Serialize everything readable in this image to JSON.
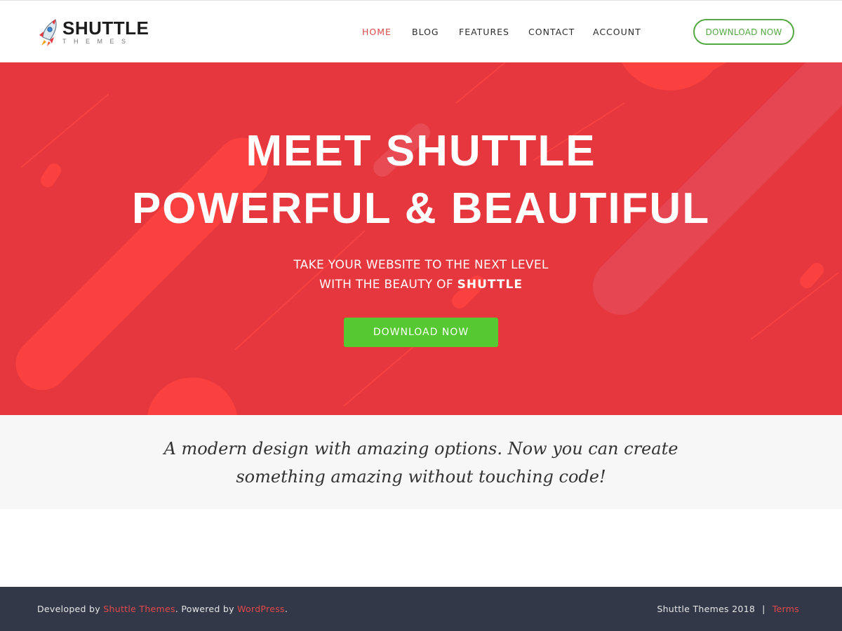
{
  "header": {
    "logo": {
      "name": "SHUTTLE",
      "sub": "THEMES"
    },
    "nav": [
      {
        "label": "HOME",
        "active": true
      },
      {
        "label": "BLOG"
      },
      {
        "label": "FEATURES"
      },
      {
        "label": "CONTACT"
      },
      {
        "label": "ACCOUNT"
      }
    ],
    "cta_label": "DOWNLOAD NOW"
  },
  "hero": {
    "title_line1": "MEET SHUTTLE",
    "title_line2": "POWERFUL & BEAUTIFUL",
    "sub_line1": "TAKE YOUR WEBSITE TO THE NEXT LEVEL",
    "sub_line2_prefix": "WITH THE BEAUTY OF ",
    "sub_line2_strong": "SHUTTLE",
    "button_label": "DOWNLOAD NOW"
  },
  "tagline": {
    "line1": "A modern design with amazing options. Now you can create",
    "line2": "something amazing without touching code!"
  },
  "footer": {
    "developed_by": "Developed by ",
    "developer_link": "Shuttle Themes",
    "powered_by": ". Powered by ",
    "platform_link": "WordPress",
    "period": ".",
    "copyright": "Shuttle Themes 2018",
    "separator": "|",
    "terms_link": "Terms"
  },
  "colors": {
    "accent_red": "#e5373d",
    "nav_active": "#d94a4a",
    "green": "#56c832",
    "outline_green": "#56a845",
    "footer_bg": "#323847",
    "link_red": "#e6484b"
  }
}
